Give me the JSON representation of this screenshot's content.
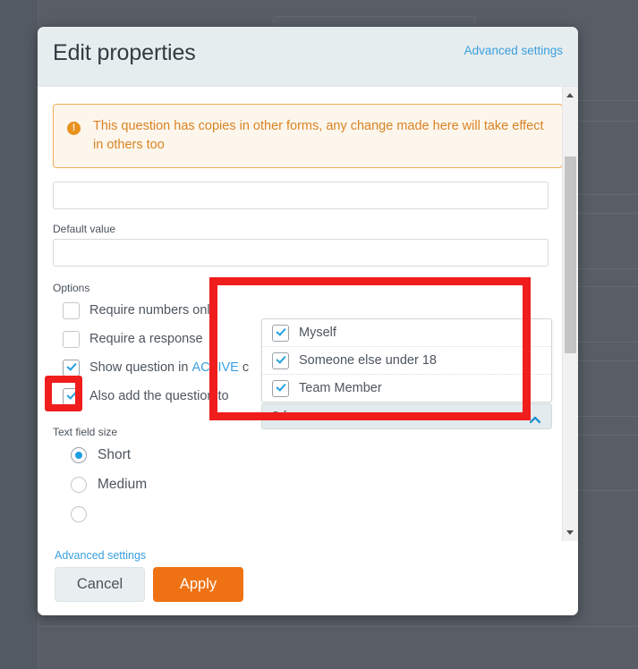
{
  "modal": {
    "title": "Edit properties",
    "header_link": "Advanced settings",
    "warning": {
      "icon": "alert-exclamation-icon",
      "text": "This question has copies in other forms, any change made here will take effect in others too"
    },
    "fields": {
      "top_input": {
        "value": "",
        "placeholder": ""
      },
      "default_value": {
        "label": "Default value",
        "value": "",
        "placeholder": ""
      }
    },
    "options": {
      "label": "Options",
      "items": [
        {
          "label": "Require numbers only",
          "checked": false
        },
        {
          "label": "Require a response",
          "checked": false
        },
        {
          "label": "Show question in ACTIVE",
          "label_suffix": " c",
          "accent_word": "ACTIVE",
          "checked": true
        },
        {
          "label": "Also add the question to",
          "checked": true
        }
      ]
    },
    "text_field_size": {
      "label": "Text field size",
      "options": [
        {
          "label": "Short",
          "selected": true
        },
        {
          "label": "Medium",
          "selected": false
        },
        {
          "label": "",
          "selected": false
        }
      ]
    },
    "footer": {
      "advanced_link": "Advanced settings",
      "cancel_label": "Cancel",
      "apply_label": "Apply"
    },
    "scrollbar": {
      "up_arrow": "scroll-up-arrow-icon",
      "down_arrow": "scroll-down-arrow-icon"
    }
  },
  "forms_dropdown": {
    "items": [
      {
        "label": "Myself",
        "checked": true
      },
      {
        "label": "Someone else under 18",
        "checked": true
      },
      {
        "label": "Team Member",
        "checked": true
      }
    ],
    "toggle_label": "3 forms",
    "chevron": "chevron-up-icon"
  },
  "colors": {
    "accent_blue": "#3a9fdc",
    "checkbox_blue": "#23a0e0",
    "apply_orange": "#ee7213",
    "warning_orange": "#d98324",
    "warning_bg": "#fdf6ec",
    "header_bg": "#e6edef",
    "annotation_red": "#f01d1d",
    "overlay": "#585d66"
  }
}
